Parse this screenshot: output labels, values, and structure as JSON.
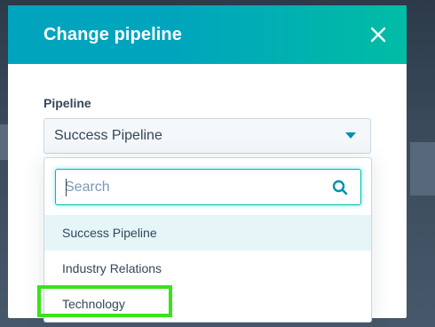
{
  "modal": {
    "title": "Change pipeline",
    "close_icon": "close-icon"
  },
  "field": {
    "label": "Pipeline",
    "selected_value": "Success Pipeline",
    "dropdown_icon": "caret-down-icon"
  },
  "dropdown": {
    "search_placeholder": "Search",
    "search_icon": "search-icon",
    "options": [
      {
        "label": "Success Pipeline",
        "highlighted": true
      },
      {
        "label": "Industry Relations",
        "highlighted": false
      },
      {
        "label": "Technology",
        "highlighted": false
      }
    ]
  },
  "colors": {
    "header_start": "#00a4bd",
    "header_end": "#00bda5",
    "text": "#33475b",
    "focus_border": "#00bda5",
    "annotation_box": "#39e21a"
  }
}
